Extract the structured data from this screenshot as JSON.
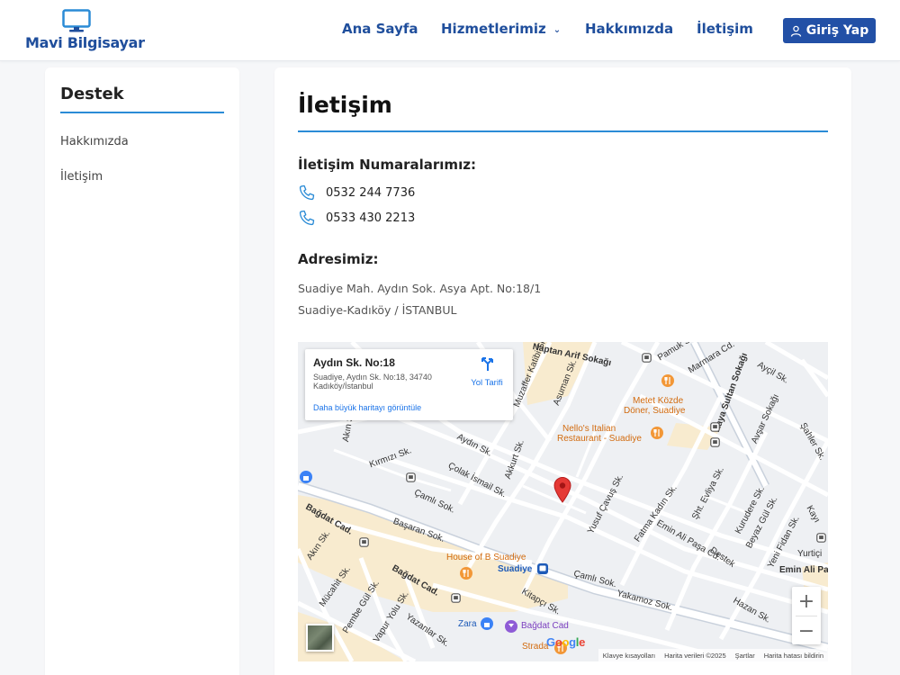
{
  "header": {
    "logo_text": "Mavi Bilgisayar",
    "nav": [
      {
        "label": "Ana Sayfa"
      },
      {
        "label": "Hizmetlerimiz"
      },
      {
        "label": "Hakkımızda"
      },
      {
        "label": "İletişim"
      }
    ],
    "login_label": "Giriş Yap"
  },
  "sidebar": {
    "title": "Destek",
    "items": [
      {
        "label": "Hakkımızda"
      },
      {
        "label": "İletişim"
      }
    ]
  },
  "main": {
    "title": "İletişim",
    "phones_title": "İletişim Numaralarımız:",
    "phones": [
      "0532 244 7736",
      "0533 430 2213"
    ],
    "address_title": "Adresimiz:",
    "address_lines": [
      "Suadiye Mah. Aydın Sok. Asya Apt. No:18/1",
      "Suadiye-Kadıköy / İSTANBUL"
    ]
  },
  "map": {
    "card": {
      "title": "Aydın Sk. No:18",
      "address_line1": "Suadiye, Aydın Sk. No:18, 34740",
      "address_line2": "Kadıköy/İstanbul",
      "larger_map_link": "Daha büyük haritayı görüntüle",
      "directions_label": "Yol Tarifi"
    },
    "labels": {
      "arif": "Naptan Arif Sokağı",
      "katibi": "Muzaffer Katibi Sk.",
      "asuman": "Asuman Sk.",
      "marmara": "Marmara Cd.",
      "pamuk": "Pamuk Sk.",
      "aycil": "Ayçil Sk.",
      "kaya": "Kaya Sultan Sokağı",
      "avsar": "Avşar Sokağı",
      "sahler": "Şahler Sk.",
      "metet1": "Metet Közde",
      "metet2": "Döner, Suadiye",
      "nellos1": "Nello's Italian",
      "nellos2": "Restaurant - Suadiye",
      "aydin": "Aydın Sk.",
      "akkurt": "Akkurt Sk.",
      "kirmizi": "Kırmızı Sk.",
      "akin_top": "Akın Sk.",
      "colak": "Çolak İsmail Sk.",
      "camli1": "Çamlı Sok.",
      "basaran": "Başaran Sok.",
      "bagdat1": "Bağdat Cad.",
      "bagdat2": "Bağdat Cad.",
      "akin": "Akın Sk.",
      "mucahit": "Mücahit Sk.",
      "pembe": "Pembe Gül Sk.",
      "vapur": "Vapur Yolu Sk.",
      "yazanlar": "Yazanlar Sk.",
      "yusuf": "Yusuf Çavuş Sk.",
      "fatma": "Fatma Kadın Sk.",
      "evliya": "Şht. Evliya Sk.",
      "emin1": "Emin Ali Paşa Cd.",
      "kurudere": "Kurudere Sk.",
      "beyaz": "Beyaz Gül Sk.",
      "yenifidan": "Yeni Fidan Sk.",
      "kayi": "Kayı",
      "yurtici": "Yurtiçi",
      "emin2": "Emin Ali Pa",
      "desteк": "Destek",
      "houseofb": "House of B Suadiye",
      "suadiye": "Suadiye",
      "camli2": "Çamlı Sok.",
      "kitapci": "Kitapçı Sk.",
      "yakamoz": "Yakamoz Sok.",
      "hazan": "Hazan Sk.",
      "zara": "Zara",
      "bagdatcad": "Bağdat Cad",
      "strada": "Strada"
    },
    "google": "Google",
    "attribution": [
      "Klavye kısayolları",
      "Harita verileri ©2025",
      "Şartlar",
      "Harita hatası bildirin"
    ],
    "zoom_in": "+",
    "zoom_out": "−"
  },
  "colors": {
    "brand": "#1f4e9c",
    "button": "#2250a6",
    "accent_line": "#2a8bd6",
    "map_pin": "#e53935",
    "poi_food": "#f29737"
  },
  "icons": {
    "logo": "monitor-icon",
    "login": "user-icon",
    "phone": "phone-icon",
    "directions": "directions-icon"
  }
}
